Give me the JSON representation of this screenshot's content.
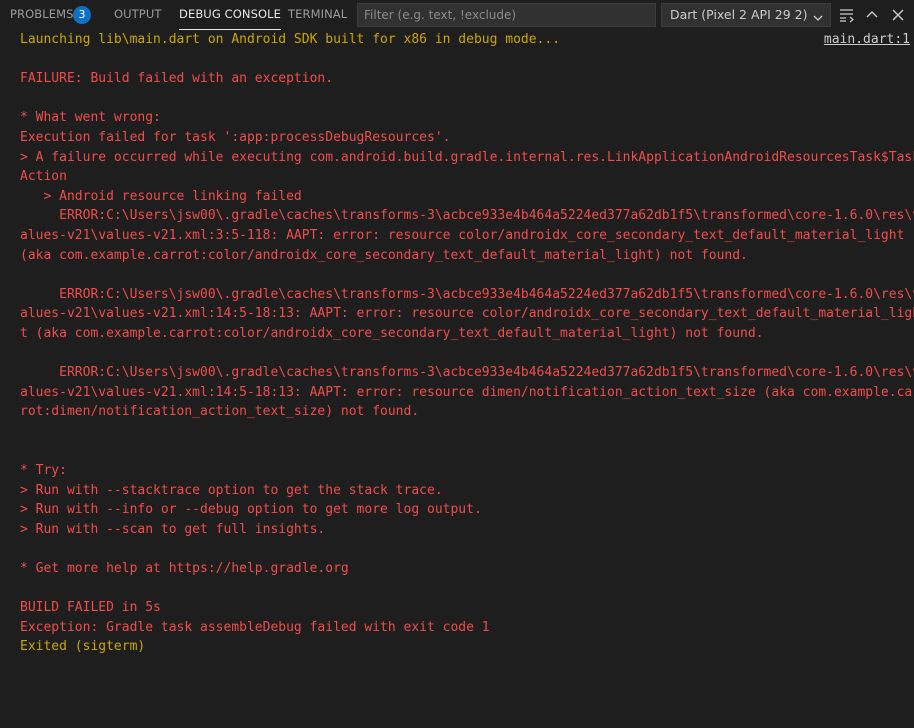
{
  "tabs": {
    "problems": {
      "label": "PROBLEMS",
      "count": "3"
    },
    "output": {
      "label": "OUTPUT"
    },
    "debug_console": {
      "label": "DEBUG CONSOLE"
    },
    "terminal": {
      "label": "TERMINAL"
    }
  },
  "filter": {
    "placeholder": "Filter (e.g. text, !exclude)",
    "value": ""
  },
  "session": {
    "selected": "Dart (Pixel 2 API 29 2)"
  },
  "actions": [
    "word-wrap-icon",
    "chevron-up-icon",
    "close-icon"
  ],
  "console": {
    "source_link": "main.dart:1",
    "lines": [
      "Launching lib\\main.dart on Android SDK built for x86 in debug mode...",
      "",
      "FAILURE: Build failed with an exception.",
      "",
      "* What went wrong:",
      "Execution failed for task ':app:processDebugResources'.",
      "> A failure occurred while executing com.android.build.gradle.internal.res.LinkApplicationAndroidResourcesTask$Task",
      "Action",
      "   > Android resource linking failed",
      "     ERROR:C:\\Users\\jsw00\\.gradle\\caches\\transforms-3\\acbce933e4b464a5224ed377a62db1f5\\transformed\\core-1.6.0\\res\\v",
      "alues-v21\\values-v21.xml:3:5-118: AAPT: error: resource color/androidx_core_secondary_text_default_material_light",
      "(aka com.example.carrot:color/androidx_core_secondary_text_default_material_light) not found.",
      "",
      "     ERROR:C:\\Users\\jsw00\\.gradle\\caches\\transforms-3\\acbce933e4b464a5224ed377a62db1f5\\transformed\\core-1.6.0\\res\\v",
      "alues-v21\\values-v21.xml:14:5-18:13: AAPT: error: resource color/androidx_core_secondary_text_default_material_ligh",
      "t (aka com.example.carrot:color/androidx_core_secondary_text_default_material_light) not found.",
      "",
      "     ERROR:C:\\Users\\jsw00\\.gradle\\caches\\transforms-3\\acbce933e4b464a5224ed377a62db1f5\\transformed\\core-1.6.0\\res\\v",
      "alues-v21\\values-v21.xml:14:5-18:13: AAPT: error: resource dimen/notification_action_text_size (aka com.example.car",
      "rot:dimen/notification_action_text_size) not found.",
      "",
      "",
      "* Try:",
      "> Run with --stacktrace option to get the stack trace.",
      "> Run with --info or --debug option to get more log output.",
      "> Run with --scan to get full insights.",
      "",
      "* Get more help at https://help.gradle.org",
      "",
      "BUILD FAILED in 5s",
      "Exception: Gradle task assembleDebug failed with exit code 1",
      "Exited (sigterm)"
    ]
  },
  "colors": {
    "error_text": "#f14c4c",
    "warning_text": "#cca700",
    "badge": "#0e70c0",
    "background": "#1e1e1e"
  }
}
